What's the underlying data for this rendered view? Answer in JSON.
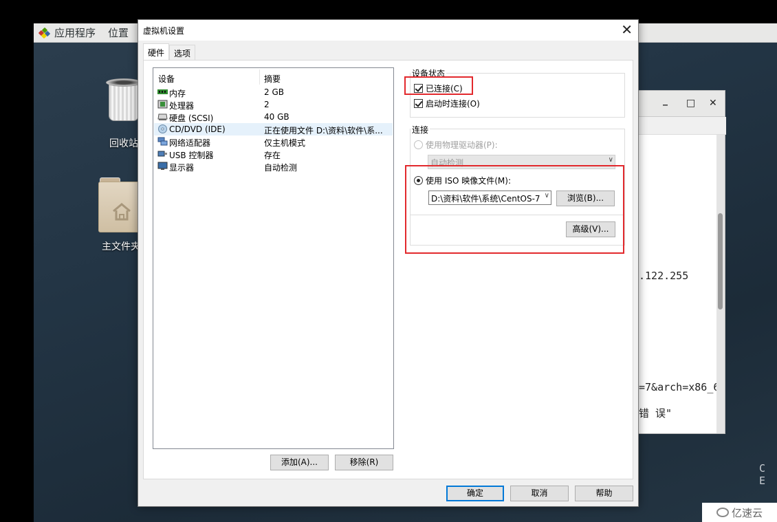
{
  "desktop": {
    "topbar": {
      "applications": "应用程序",
      "places": "位置"
    },
    "icons": [
      {
        "label": "回收站"
      },
      {
        "label": "主文件夹"
      }
    ],
    "side_text": "C E",
    "watermark": "亿速云"
  },
  "terminal": {
    "buttons": {
      "minimize": "_",
      "maximize": "□",
      "close": "✕"
    },
    "lines": [
      ".122.255",
      "=7&arch=x86_6",
      "错 误\""
    ]
  },
  "dialog": {
    "title": "虚拟机设置",
    "close": "✕",
    "tabs": [
      {
        "label": "硬件",
        "active": true
      },
      {
        "label": "选项",
        "active": false
      }
    ],
    "device_list": {
      "columns": [
        "设备",
        "摘要"
      ],
      "rows": [
        {
          "icon": "memory-icon",
          "device": "内存",
          "summary": "2 GB",
          "selected": false
        },
        {
          "icon": "cpu-icon",
          "device": "处理器",
          "summary": "2",
          "selected": false
        },
        {
          "icon": "harddisk-icon",
          "device": "硬盘 (SCSI)",
          "summary": "40 GB",
          "selected": false
        },
        {
          "icon": "cd-dvd-icon",
          "device": "CD/DVD (IDE)",
          "summary": "正在使用文件 D:\\资料\\软件\\系...",
          "selected": true
        },
        {
          "icon": "network-adapter-icon",
          "device": "网络适配器",
          "summary": "仅主机模式",
          "selected": false
        },
        {
          "icon": "usb-controller-icon",
          "device": "USB 控制器",
          "summary": "存在",
          "selected": false
        },
        {
          "icon": "display-icon",
          "device": "显示器",
          "summary": "自动检测",
          "selected": false
        }
      ]
    },
    "add_button": "添加(A)...",
    "remove_button": "移除(R)",
    "device_status": {
      "label": "设备状态",
      "connected": {
        "label": "已连接(C)",
        "checked": true
      },
      "connect_at_power_on": {
        "label": "启动时连接(O)",
        "checked": true
      }
    },
    "connection": {
      "label": "连接",
      "physical_drive": {
        "label": "使用物理驱动器(P):",
        "selected": false,
        "enabled": false
      },
      "physical_drive_value": "自动检测",
      "iso_image": {
        "label": "使用 ISO 映像文件(M):",
        "selected": true
      },
      "iso_path": "D:\\资料\\软件\\系统\\CentOS-7",
      "browse_button": "浏览(B)...",
      "advanced_button": "高级(V)..."
    },
    "ok_button": "确定",
    "cancel_button": "取消",
    "help_button": "帮助"
  },
  "colors": {
    "highlight": "#e2282c",
    "selection": "#e5f1fb",
    "primary_border": "#0078d7"
  }
}
